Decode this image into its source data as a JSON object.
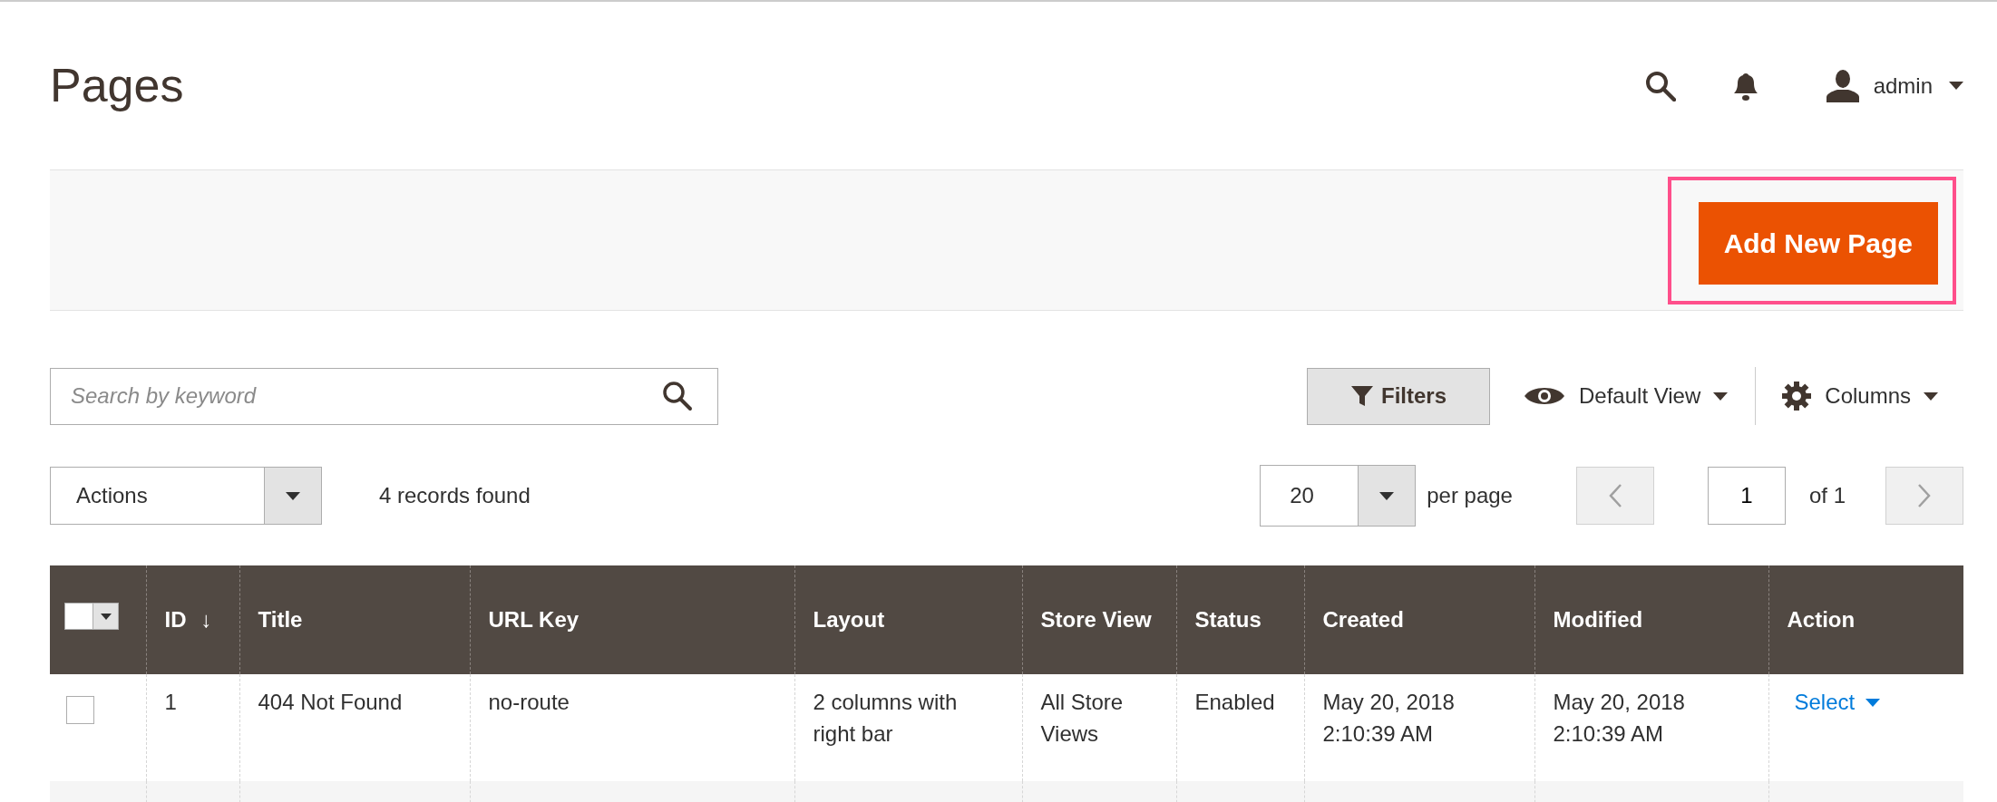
{
  "page_title": "Pages",
  "header": {
    "user": "admin"
  },
  "action_bar": {
    "primary_button": "Add New Page",
    "highlighted": true
  },
  "toolbar": {
    "search": {
      "placeholder": "Search by keyword"
    },
    "filters_button": "Filters",
    "view_menu": "Default View",
    "columns_menu": "Columns"
  },
  "mass_actions": {
    "value": "Actions"
  },
  "records_found": "4 records found",
  "pagination": {
    "per_page": "20",
    "per_page_label": "per page",
    "page": "1",
    "of_pages": "of 1"
  },
  "table": {
    "select_all": {
      "checked": false
    },
    "columns": [
      {
        "label": "ID",
        "sort": "↓"
      },
      {
        "label": "Title"
      },
      {
        "label": "URL Key"
      },
      {
        "label": "Layout"
      },
      {
        "label": "Store View"
      },
      {
        "label": "Status"
      },
      {
        "label": "Created"
      },
      {
        "label": "Modified"
      },
      {
        "label": "Action"
      }
    ],
    "rows": [
      {
        "selected": false,
        "cells": [
          "1",
          "404 Not Found",
          "no-route",
          "2 columns with right bar",
          "All Store Views",
          "Enabled",
          "May 20, 2018 2:10:39 AM",
          "May 20, 2018 2:10:39 AM"
        ],
        "action": "Select"
      }
    ]
  }
}
